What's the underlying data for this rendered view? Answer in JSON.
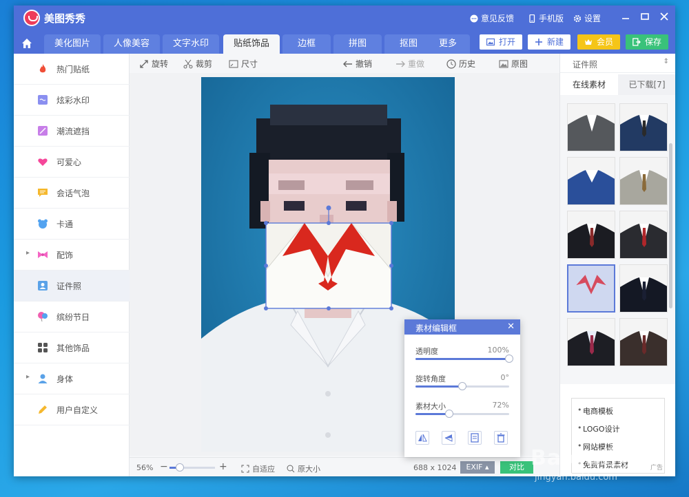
{
  "app": {
    "title": "美图秀秀",
    "feedback": "意见反馈",
    "mobile": "手机版",
    "settings": "设置"
  },
  "tabs": [
    {
      "label": "美化图片"
    },
    {
      "label": "人像美容"
    },
    {
      "label": "文字水印"
    },
    {
      "label": "贴纸饰品",
      "active": true
    },
    {
      "label": "边框"
    },
    {
      "label": "拼图"
    },
    {
      "label": "抠图"
    },
    {
      "label": "更多"
    }
  ],
  "actions": {
    "open": "打开",
    "new": "新建",
    "vip": "会员",
    "save": "保存"
  },
  "sidebar": {
    "items": [
      {
        "label": "热门贴纸",
        "icon": "flame-icon",
        "color": "#f04e37"
      },
      {
        "label": "炫彩水印",
        "icon": "watermark-icon",
        "color": "#8a8ff0"
      },
      {
        "label": "潮流遮挡",
        "icon": "shade-icon",
        "color": "#c77ee8"
      },
      {
        "label": "可爱心",
        "icon": "heart-icon",
        "color": "#f5479a"
      },
      {
        "label": "会话气泡",
        "icon": "bubble-icon",
        "color": "#f5b82e"
      },
      {
        "label": "卡通",
        "icon": "bear-icon",
        "color": "#53a3f0"
      },
      {
        "label": "配饰",
        "icon": "bow-icon",
        "color": "#f565c4",
        "expandable": true
      },
      {
        "label": "证件照",
        "icon": "idcard-icon",
        "color": "#5aa2e8",
        "selected": true
      },
      {
        "label": "缤纷节日",
        "icon": "balloon-icon",
        "color": "#f060b0"
      },
      {
        "label": "其他饰品",
        "icon": "grid-icon",
        "color": "#555555"
      },
      {
        "label": "身体",
        "icon": "person-icon",
        "color": "#5aa2e8",
        "expandable": true
      },
      {
        "label": "用户自定义",
        "icon": "pencil-icon",
        "color": "#f5b82e"
      }
    ]
  },
  "toolbar": {
    "rotate": "旋转",
    "crop": "裁剪",
    "size": "尺寸",
    "undo": "撤销",
    "redo": "重做",
    "history": "历史",
    "original": "原图"
  },
  "status": {
    "zoom": "56%",
    "zoom_fraction": 0.22,
    "fit": "自适应",
    "actual": "原大小",
    "dimensions": "688 x 1024",
    "exif": "EXIF",
    "compare": "对比"
  },
  "right_panel": {
    "category": "证件照",
    "tab_online": "在线素材",
    "tab_downloaded": "已下载[7]",
    "ads": [
      "电商模板",
      "LOGO设计",
      "网站模板",
      "免费背景素材"
    ],
    "ad_label": "广告"
  },
  "editor": {
    "title": "素材编辑框",
    "opacity_label": "透明度",
    "opacity_value": "100%",
    "opacity": 1.0,
    "rotation_label": "旋转角度",
    "rotation_value": "0°",
    "rotation": 0.5,
    "size_label": "素材大小",
    "size_value": "72%",
    "size": 0.36
  },
  "watermark": {
    "text": "Baidu经验",
    "sub": "jingyan.baidu.com"
  }
}
